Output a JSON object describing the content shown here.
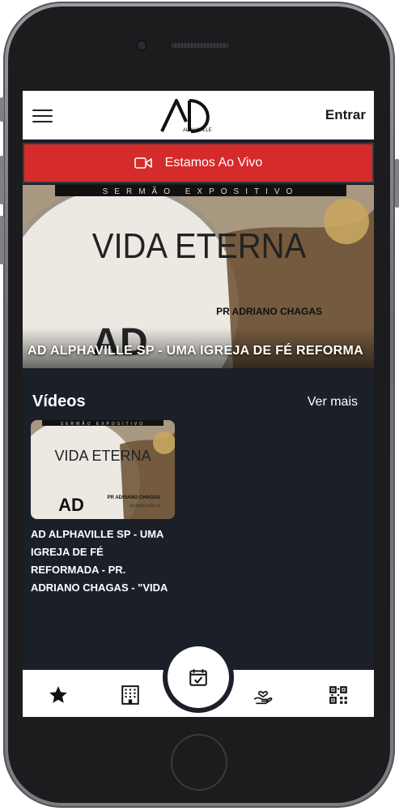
{
  "header": {
    "logo_text": "AD",
    "logo_subtext": "ALPHAVILLE",
    "login_label": "Entrar"
  },
  "live": {
    "label": "Estamos Ao Vivo",
    "color": "#d52b2b"
  },
  "hero": {
    "banner_text": "SERMÃO EXPOSITIVO",
    "image_title": "VIDA ETERNA",
    "image_preacher": "PR ADRIANO CHAGAS",
    "image_logo": "AD",
    "title": "AD ALPHAVILLE SP - UMA IGREJA DE FÉ REFORMA"
  },
  "videos": {
    "section_title": "Vídeos",
    "see_more_label": "Ver mais",
    "items": [
      {
        "thumb_banner": "SERMÃO EXPOSITIVO",
        "thumb_title": "VIDA ETERNA",
        "thumb_preacher": "PR ADRIANO CHAGAS",
        "thumb_handle": "@adalphaville.sp",
        "thumb_logo": "AD",
        "title": "AD ALPHAVILLE SP - UMA IGREJA DE FÉ REFORMADA - PR. ADRIANO CHAGAS - \"VIDA"
      }
    ]
  },
  "tabbar": {
    "items": [
      {
        "icon": "star-icon"
      },
      {
        "icon": "building-icon"
      },
      {
        "icon": "calendar-check-icon"
      },
      {
        "icon": "hand-heart-icon"
      },
      {
        "icon": "qr-code-icon"
      }
    ]
  },
  "colors": {
    "background": "#1b1f28",
    "accent": "#d52b2b"
  }
}
